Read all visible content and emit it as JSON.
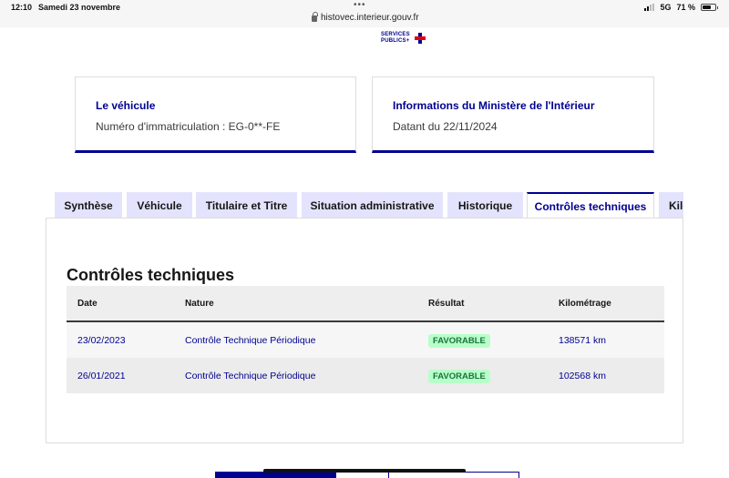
{
  "status_bar": {
    "time": "12:10",
    "date": "Samedi 23 novembre",
    "url": "histovec.interieur.gouv.fr",
    "network": "5G",
    "battery": "71 %",
    "battery_level": 0.71
  },
  "logo": {
    "line1": "SERVICES",
    "line2": "PUBLICS+",
    "colors": {
      "blue": "#000091",
      "red": "#e1000f"
    }
  },
  "vehicle_card": {
    "title": "Le véhicule",
    "plate_text": "Numéro d'immatriculation : EG-0**-FE"
  },
  "ministry_card": {
    "title": "Informations du Ministère de l'Intérieur",
    "date_text": "Datant du 22/11/2024"
  },
  "tabs": [
    {
      "label": "Synthèse"
    },
    {
      "label": "Véhicule"
    },
    {
      "label": "Titulaire et Titre"
    },
    {
      "label": "Situation administrative"
    },
    {
      "label": "Historique"
    },
    {
      "label": "Contrôles techniques",
      "active": true
    },
    {
      "label": "Kilométrage"
    }
  ],
  "section": {
    "title": "Contrôles techniques",
    "columns": [
      "Date",
      "Nature",
      "Résultat",
      "Kilométrage"
    ],
    "rows": [
      {
        "date": "23/02/2023",
        "nature": "Contrôle Technique Périodique",
        "result": "FAVORABLE",
        "km": "138571 km"
      },
      {
        "date": "26/01/2021",
        "nature": "Contrôle Technique Périodique",
        "result": "FAVORABLE",
        "km": "102568 km"
      }
    ]
  },
  "colors": {
    "primary": "#000091",
    "tab_bg": "#e3e3fd",
    "badge_bg": "#b8fec9",
    "badge_text": "#18753c"
  }
}
